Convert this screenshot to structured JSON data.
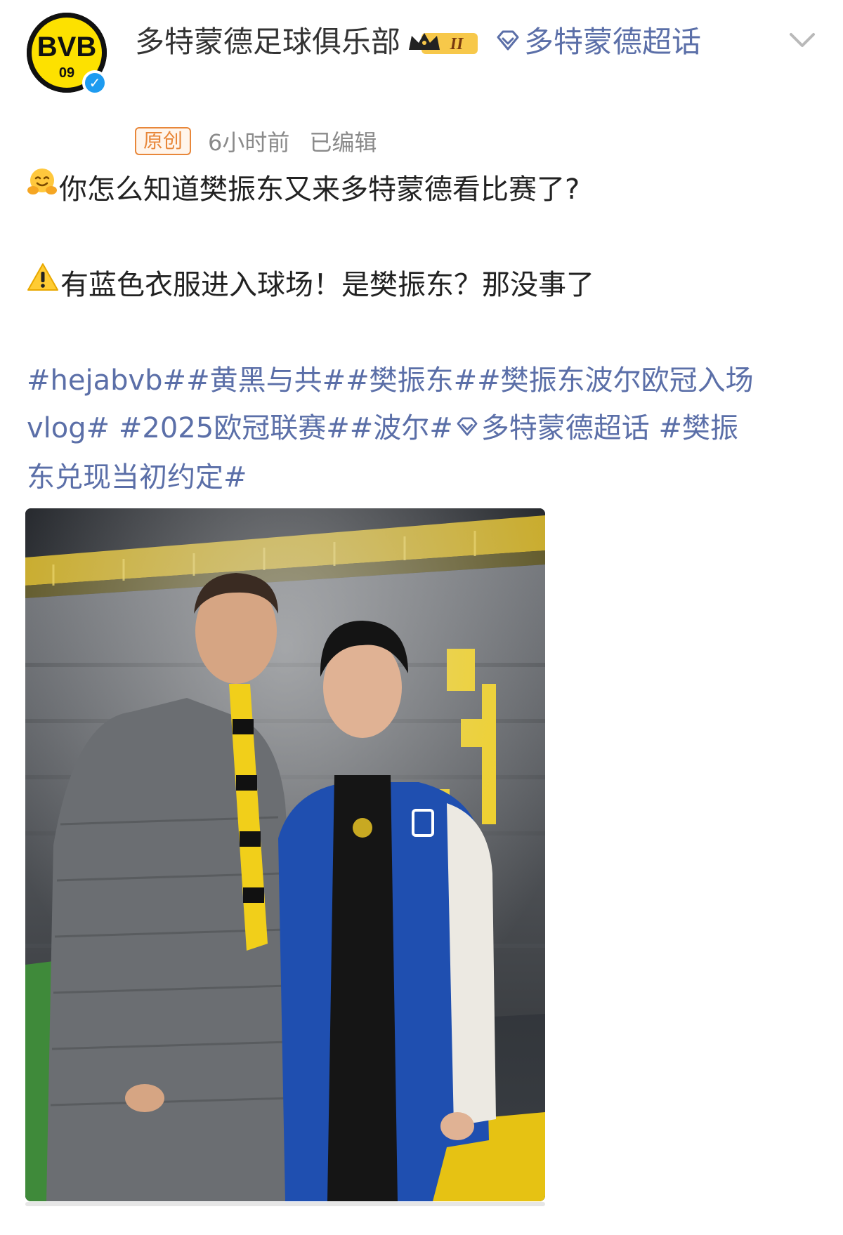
{
  "post": {
    "author_name": "多特蒙德足球俱乐部",
    "vip_badge": "II",
    "super_topic_label": "多特蒙德超话",
    "original_tag": "原创",
    "time": "6小时前",
    "edited": "已编辑",
    "line1": "你怎么知道樊振东又来多特蒙德看比赛了?",
    "line2": "有蓝色衣服进入球场！是樊振东？那没事了",
    "hashtags": {
      "t1": "#hejabvb#",
      "t2": "#黄黑与共#",
      "t3": "#樊振东#",
      "t4a": "#樊振东波尔欧冠入场",
      "t4b": "vlog#",
      "t5": "#2025欧冠联赛#",
      "t6": "#波尔#",
      "t7": "多特蒙德超话",
      "t8a": "#樊振",
      "t8b": "东兑现当初约定#"
    }
  },
  "avatar": {
    "logo_top": "BVB",
    "logo_bottom": "09"
  },
  "colors": {
    "link": "#5b6fa8",
    "bvb_yellow": "#fde100",
    "orig": "#e8873a",
    "verified": "#1e9bf0"
  },
  "icons": [
    "bvb-logo",
    "verified-icon",
    "crown-icon",
    "diamond-icon",
    "chevron-down-icon",
    "hug-emoji-icon",
    "warning-icon"
  ]
}
